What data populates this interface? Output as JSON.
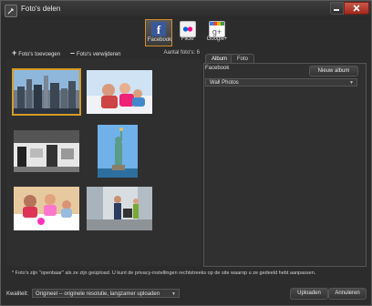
{
  "window": {
    "title": "Foto's delen"
  },
  "services": [
    {
      "label": "Facebook",
      "icon": "facebook-icon",
      "selected": true
    },
    {
      "label": "Flickr",
      "icon": "flickr-icon",
      "selected": false
    },
    {
      "label": "Google+",
      "icon": "google-plus-icon",
      "selected": false
    }
  ],
  "toolbar": {
    "add_label": "Foto's toevoegen",
    "remove_label": "Foto's verwijderen",
    "count_label": "Aantal foto's: 6"
  },
  "photos": [
    {
      "subject": "city skyline",
      "selected": true
    },
    {
      "subject": "people on sofa",
      "selected": false
    },
    {
      "subject": "terrace cafe",
      "selected": false
    },
    {
      "subject": "statue of liberty",
      "selected": false
    },
    {
      "subject": "family at table",
      "selected": false
    },
    {
      "subject": "family on street",
      "selected": false
    }
  ],
  "tabs": {
    "album": "Album",
    "foto": "Foto"
  },
  "album": {
    "facebook_label": "Facebook",
    "new_album_button": "Nieuw album",
    "selected_album": "Wall Photos"
  },
  "footnote": "* Foto's zijn \"openbaar\" als ze zijn geüpload. U kunt de privacy-instellingen rechtstreeks op de site waarop u ze gedeeld hebt aanpassen.",
  "quality": {
    "label": "Kwaliteit:",
    "selected": "Origineel -- originele resolutie, langzamer uploaden"
  },
  "buttons": {
    "upload": "Uploaden",
    "cancel": "Annuleren"
  },
  "colors": {
    "accent": "#d69a28",
    "facebook": "#3b5998",
    "close_red": "#b8392d",
    "background": "#2c2c2c"
  }
}
